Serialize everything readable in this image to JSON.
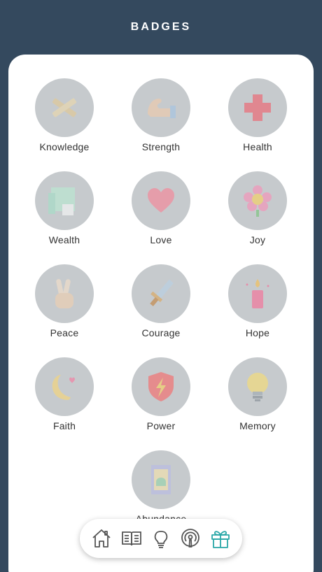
{
  "header": {
    "title": "BADGES"
  },
  "badges": [
    {
      "label": "Knowledge",
      "icon": "crossed-scrolls-icon"
    },
    {
      "label": "Strength",
      "icon": "flexed-arm-icon"
    },
    {
      "label": "Health",
      "icon": "medical-cross-icon"
    },
    {
      "label": "Wealth",
      "icon": "money-stack-icon"
    },
    {
      "label": "Love",
      "icon": "heart-icon"
    },
    {
      "label": "Joy",
      "icon": "flower-icon"
    },
    {
      "label": "Peace",
      "icon": "peace-hand-icon"
    },
    {
      "label": "Courage",
      "icon": "sword-icon"
    },
    {
      "label": "Hope",
      "icon": "candle-icon"
    },
    {
      "label": "Faith",
      "icon": "crescent-moon-icon"
    },
    {
      "label": "Power",
      "icon": "lightning-shield-icon"
    },
    {
      "label": "Memory",
      "icon": "lightbulb-icon"
    },
    {
      "label": "Abundance",
      "icon": "rug-icon"
    }
  ],
  "colors": {
    "background": "#34495e",
    "badge_circle": "#c6cacd",
    "active_nav": "#2aa8a8",
    "nav_icon": "#555555"
  },
  "navbar": {
    "items": [
      {
        "icon": "home-icon",
        "active": false
      },
      {
        "icon": "open-book-icon",
        "active": false
      },
      {
        "icon": "lightbulb-icon",
        "active": false
      },
      {
        "icon": "podcast-icon",
        "active": false
      },
      {
        "icon": "gift-icon",
        "active": true
      }
    ]
  }
}
